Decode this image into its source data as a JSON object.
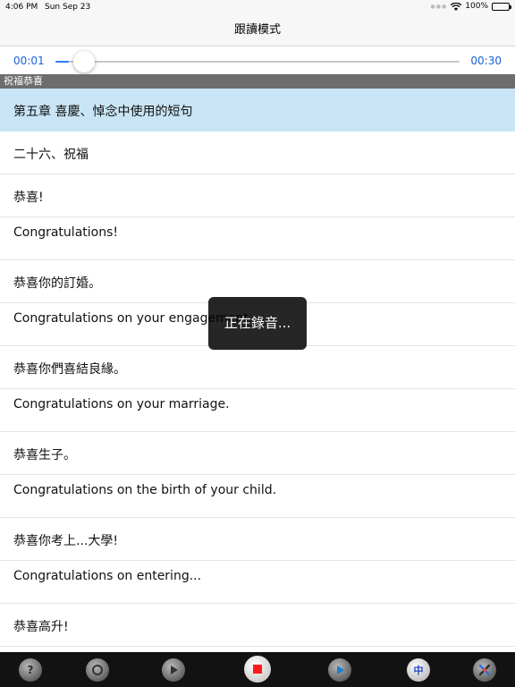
{
  "status_bar": {
    "time": "4:06 PM",
    "date": "Sun Sep 23",
    "battery": "100%"
  },
  "nav": {
    "title": "跟讀模式"
  },
  "player": {
    "elapsed": "00:01",
    "duration": "00:30",
    "progress": 0.033
  },
  "section": {
    "title": "祝福恭喜"
  },
  "rows": [
    {
      "text": "第五章 喜慶、悼念中使用的短句",
      "kind": "cn",
      "selected": true
    },
    {
      "text": "二十六、祝福",
      "kind": "cn"
    },
    {
      "text": "恭喜!",
      "kind": "cn"
    },
    {
      "text": "Congratulations!",
      "kind": "en"
    },
    {
      "text": "恭喜你的訂婚。",
      "kind": "cn"
    },
    {
      "text": "Congratulations on your engagement.",
      "kind": "en"
    },
    {
      "text": "恭喜你們喜結良緣。",
      "kind": "cn"
    },
    {
      "text": "Congratulations on your marriage.",
      "kind": "en"
    },
    {
      "text": "恭喜生子。",
      "kind": "cn"
    },
    {
      "text": "Congratulations on the birth of your child.",
      "kind": "en"
    },
    {
      "text": "恭喜你考上...大學!",
      "kind": "cn"
    },
    {
      "text": "Congratulations on entering...",
      "kind": "en"
    },
    {
      "text": "恭喜高升!",
      "kind": "cn"
    }
  ],
  "toast": {
    "text": "正在錄音..."
  },
  "toolbar": {
    "help_label": "?",
    "lang_label": "中",
    "icons": [
      "help-icon",
      "repeat-icon",
      "play-icon",
      "stop-record-icon",
      "play-recording-icon",
      "language-icon",
      "settings-icon"
    ],
    "colors": {
      "stop": "#ff1a1a",
      "accent": "#1b7fd0",
      "lang_text": "#2145c9"
    }
  }
}
